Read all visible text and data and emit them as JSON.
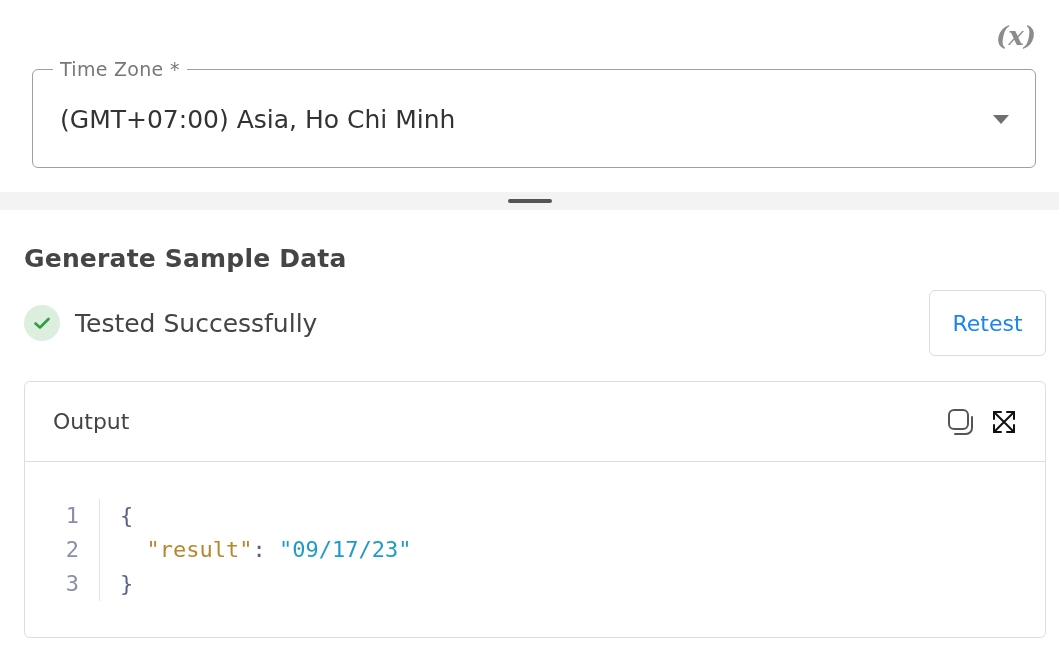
{
  "variable_button": {
    "label": "(x)"
  },
  "time_zone_field": {
    "label": "Time Zone *",
    "value": "(GMT+07:00) Asia, Ho Chi Minh"
  },
  "sample_data": {
    "title": "Generate Sample Data",
    "status": {
      "kind": "success",
      "text": "Tested Successfully"
    },
    "retest_button": "Retest"
  },
  "output": {
    "title": "Output",
    "lines": [
      {
        "number": "1",
        "tokens": [
          {
            "kind": "punct",
            "text": "{"
          }
        ],
        "children": [
          {
            "number": "2",
            "tokens": [
              {
                "kind": "key",
                "text": "\"result\""
              },
              {
                "kind": "punct",
                "text": ": "
              },
              {
                "kind": "string",
                "text": "\"09/17/23\""
              }
            ]
          }
        ]
      },
      {
        "number": "3",
        "tokens": [
          {
            "kind": "punct",
            "text": "}"
          }
        ]
      }
    ]
  }
}
